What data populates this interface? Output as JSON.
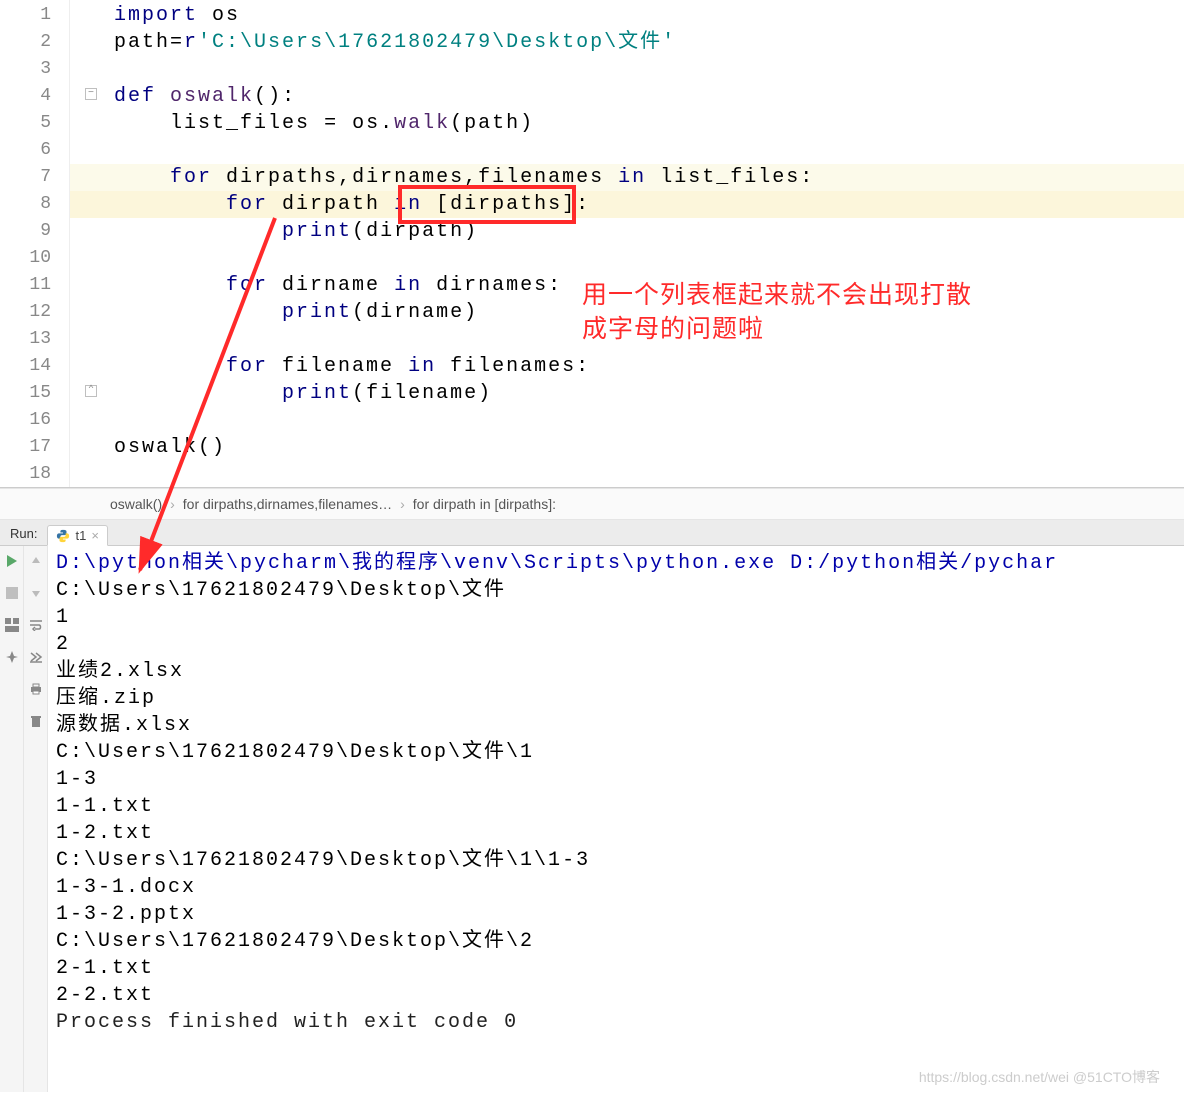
{
  "editor": {
    "line_numbers": [
      "1",
      "2",
      "3",
      "4",
      "5",
      "6",
      "7",
      "8",
      "9",
      "10",
      "11",
      "12",
      "13",
      "14",
      "15",
      "16",
      "17",
      "18"
    ],
    "tokens": {
      "import": "import",
      "os": "os",
      "path": "path",
      "eq": "=",
      "rpfx": "r",
      "pathstr": "'C:\\Users\\17621802479\\Desktop\\文件'",
      "def": "def",
      "oswalk": "oswalk",
      "paren_open": "(",
      "paren_close": ")",
      "colon": ":",
      "list_files": "list_files",
      "walk": "walk",
      "pathvar": "path",
      "for": "for",
      "dirpaths": "dirpaths",
      "comma": ",",
      "dirnames": "dirnames",
      "filenames": "filenames",
      "in": "in",
      "lf": "list_files",
      "dirpath": "dirpath",
      "brkL": "[",
      "brkR": "]",
      "print": "print",
      "dirname": "dirname",
      "filename": "filename"
    }
  },
  "annotation": {
    "line1": "用一个列表框起来就不会出现打散",
    "line2": "成字母的问题啦"
  },
  "breadcrumb": {
    "a": "oswalk()",
    "b": "for dirpaths,dirnames,filenames…",
    "c": "for dirpath in [dirpaths]:"
  },
  "run": {
    "label": "Run:",
    "tab": "t1"
  },
  "console": {
    "cmd": "D:\\python相关\\pycharm\\我的程序\\venv\\Scripts\\python.exe D:/python相关/pychar",
    "lines": [
      "C:\\Users\\17621802479\\Desktop\\文件",
      "1",
      "2",
      "业绩2.xlsx",
      "压缩.zip",
      "源数据.xlsx",
      "C:\\Users\\17621802479\\Desktop\\文件\\1",
      "1-3",
      "1-1.txt",
      "1-2.txt",
      "C:\\Users\\17621802479\\Desktop\\文件\\1\\1-3",
      "1-3-1.docx",
      "1-3-2.pptx",
      "C:\\Users\\17621802479\\Desktop\\文件\\2",
      "2-1.txt",
      "2-2.txt",
      "",
      "Process finished with exit code 0"
    ],
    "exit": "Process finished with exit code 0"
  },
  "watermark": "https://blog.csdn.net/wei @51CTO博客"
}
